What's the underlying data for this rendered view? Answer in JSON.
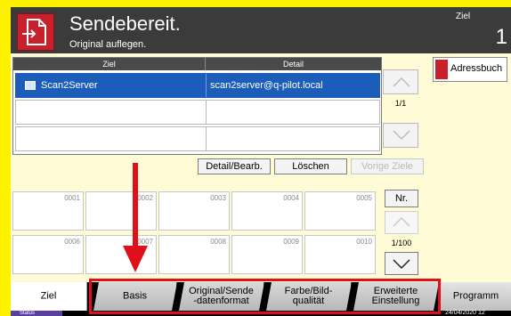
{
  "header": {
    "title": "Sendebereit.",
    "subtitle": "Original auflegen.",
    "dest_label": "Ziel",
    "dest_count": "1"
  },
  "dest_table": {
    "col_ziel": "Ziel",
    "col_detail": "Detail",
    "rows": [
      {
        "name": "Scan2Server",
        "detail": "scan2server@q-pilot.local",
        "selected": true
      },
      {
        "name": "",
        "detail": "",
        "selected": false
      },
      {
        "name": "",
        "detail": "",
        "selected": false
      }
    ],
    "page_indicator": "1/1"
  },
  "address_book_label": "Adressbuch",
  "actions": {
    "detail_edit": "Detail/Bearb.",
    "delete": "Löschen",
    "previous_targets": "Vorige Ziele"
  },
  "one_touch": {
    "slots_row1": [
      "0001",
      "0002",
      "0003",
      "0004",
      "0005"
    ],
    "slots_row2": [
      "0006",
      "0007",
      "0008",
      "0009",
      "0010"
    ],
    "nr_button": "Nr.",
    "page_indicator": "1/100"
  },
  "tabs": {
    "ziel": "Ziel",
    "basis": "Basis",
    "original_line1": "Original/Sende",
    "original_line2": "-datenformat",
    "farbe_line1": "Farbe/Bild-",
    "farbe_line2": "qualität",
    "erweitert_line1": "Erweiterte",
    "erweitert_line2": "Einstellung",
    "programm": "Programm"
  },
  "status": {
    "label": "Status",
    "date": "24/04/2020  12"
  },
  "colors": {
    "frame": "#fff200",
    "header_bg": "#3b3b3b",
    "accent_red": "#c9212b",
    "selection_blue": "#1b5db9",
    "annotation_red": "#e0101a"
  }
}
